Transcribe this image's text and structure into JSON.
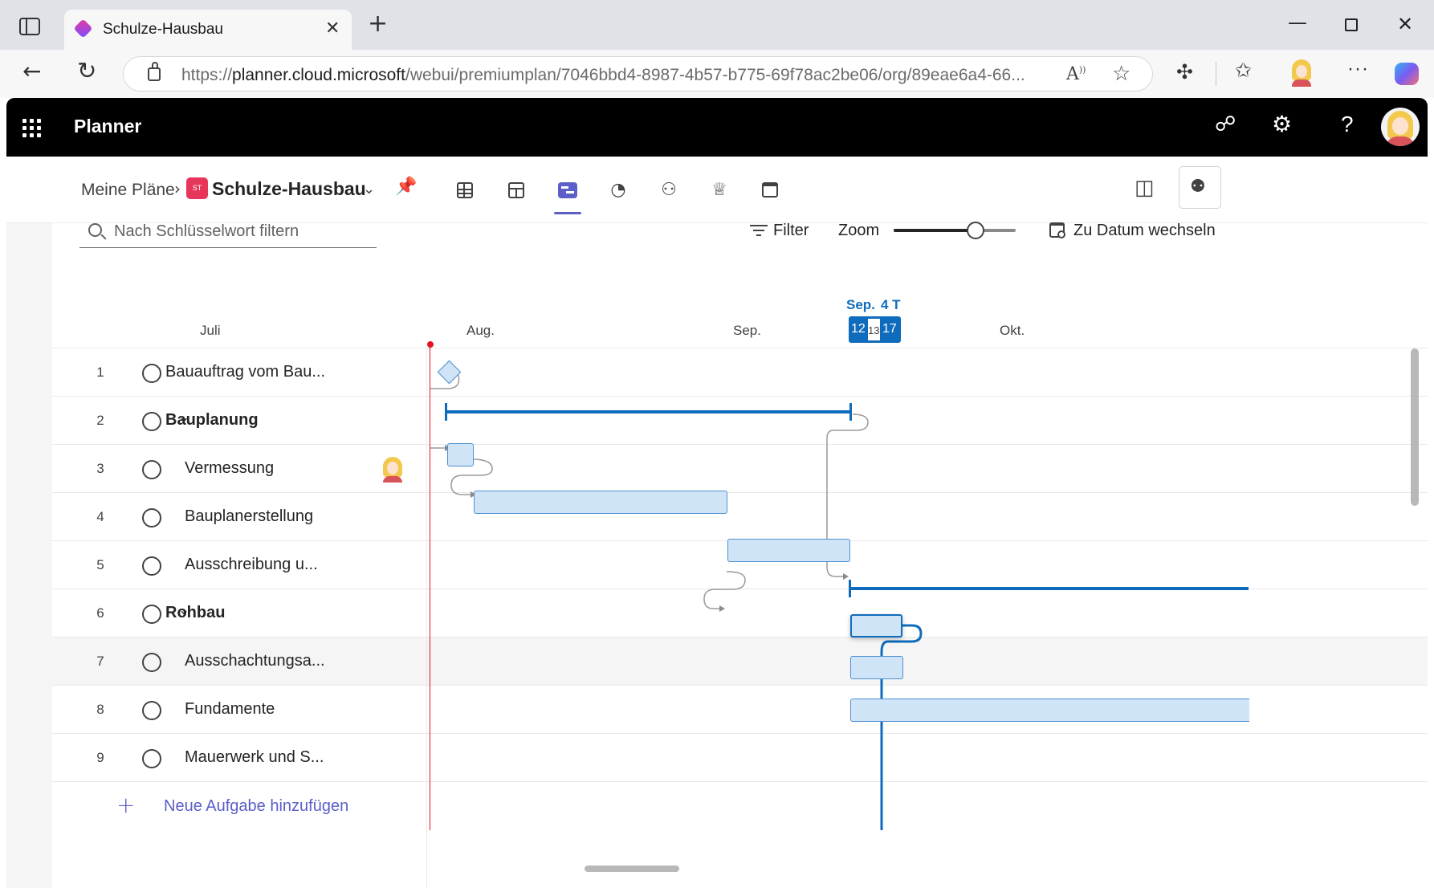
{
  "browser": {
    "tab_title": "Schulze-Hausbau",
    "url_prefix": "https://",
    "url_host": "planner.cloud.microsoft",
    "url_path": "/webui/premiumplan/7046bbd4-8987-4b57-b775-69f78ac2be06/org/89eae6a4-66..."
  },
  "suite": {
    "app_name": "Planner"
  },
  "plan": {
    "breadcrumb_root": "Meine Pläne",
    "badge": "ST",
    "name": "Schulze-Hausbau",
    "badge_color": "#e8365a",
    "accent": "#5b5fc7"
  },
  "toolbar": {
    "search_placeholder": "Nach Schlüsselwort filtern",
    "filter_label": "Filter",
    "zoom_label": "Zoom",
    "zoom_level": 0.7,
    "goto_date_label": "Zu Datum wechseln"
  },
  "timeline": {
    "months": [
      "Juli",
      "Aug.",
      "Sep.",
      "Okt."
    ],
    "selection_month": "Sep.",
    "selection_duration": "4 T",
    "selection_start": "12",
    "selection_mid": "13",
    "selection_end": "17"
  },
  "tasks": [
    {
      "num": "1",
      "name": "Bauauftrag vom Bau...",
      "type": "milestone"
    },
    {
      "num": "2",
      "name": "Bauplanung",
      "type": "summary"
    },
    {
      "num": "3",
      "name": "Vermessung",
      "type": "task",
      "assigned": true
    },
    {
      "num": "4",
      "name": "Bauplanerstellung",
      "type": "task"
    },
    {
      "num": "5",
      "name": "Ausschreibung u...",
      "type": "task"
    },
    {
      "num": "6",
      "name": "Rohbau",
      "type": "summary"
    },
    {
      "num": "7",
      "name": "Ausschachtungsa...",
      "type": "task"
    },
    {
      "num": "8",
      "name": "Fundamente",
      "type": "task"
    },
    {
      "num": "9",
      "name": "Mauerwerk und S...",
      "type": "task"
    }
  ],
  "add_task_label": "Neue Aufgabe hinzufügen"
}
